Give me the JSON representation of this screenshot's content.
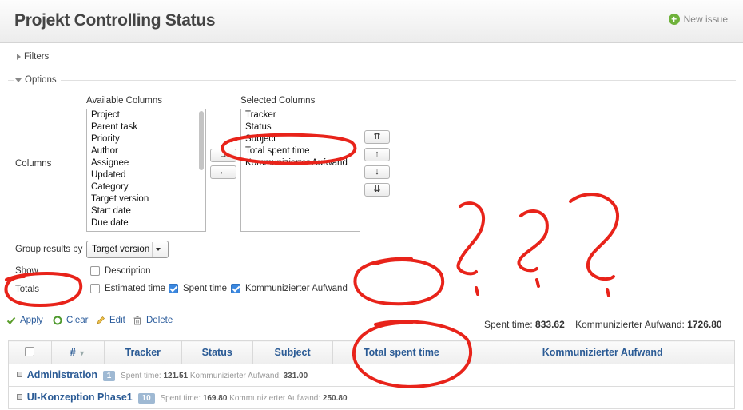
{
  "header": {
    "title": "Projekt Controlling Status",
    "new_issue_label": "New issue"
  },
  "filters": {
    "legend": "Filters"
  },
  "options": {
    "legend": "Options",
    "columns_label": "Columns",
    "available_label": "Available Columns",
    "available_columns": [
      "Project",
      "Parent task",
      "Priority",
      "Author",
      "Assignee",
      "Updated",
      "Category",
      "Target version",
      "Start date",
      "Due date"
    ],
    "selected_label": "Selected Columns",
    "selected_columns": [
      "Tracker",
      "Status",
      "Subject",
      "Total spent time",
      "Kommunizierter Aufwand"
    ],
    "move_right": "→",
    "move_left": "←",
    "order_top": "⇈",
    "order_up": "↑",
    "order_down": "↓",
    "order_bottom": "⇊",
    "group_by_label": "Group results by",
    "group_by_value": "Target version",
    "show_label": "Show",
    "show_options": [
      {
        "label": "Description",
        "checked": false
      }
    ],
    "totals_label": "Totals",
    "totals_options": [
      {
        "label": "Estimated time",
        "checked": false
      },
      {
        "label": "Spent time",
        "checked": true
      },
      {
        "label": "Kommunizierter Aufwand",
        "checked": true
      }
    ]
  },
  "actions": {
    "apply": "Apply",
    "clear": "Clear",
    "edit": "Edit",
    "delete": "Delete"
  },
  "totals_summary": {
    "spent_label": "Spent time:",
    "spent_value": "833.62",
    "aufwand_label": "Kommunizierter Aufwand:",
    "aufwand_value": "1726.80"
  },
  "table": {
    "headers": [
      "#",
      "Tracker",
      "Status",
      "Subject",
      "Total spent time",
      "Kommunizierter Aufwand"
    ],
    "groups": [
      {
        "name": "Administration",
        "count": "1",
        "spent_label": "Spent time:",
        "spent": "121.51",
        "aufwand_label": "Kommunizierter Aufwand:",
        "aufwand": "331.00"
      },
      {
        "name": "UI-Konzeption Phase1",
        "count": "10",
        "spent_label": "Spent time:",
        "spent": "169.80",
        "aufwand_label": "Kommunizierter Aufwand:",
        "aufwand": "250.80"
      }
    ]
  },
  "annotation_color": "#e8231a",
  "accent_color": "#2b5b95"
}
